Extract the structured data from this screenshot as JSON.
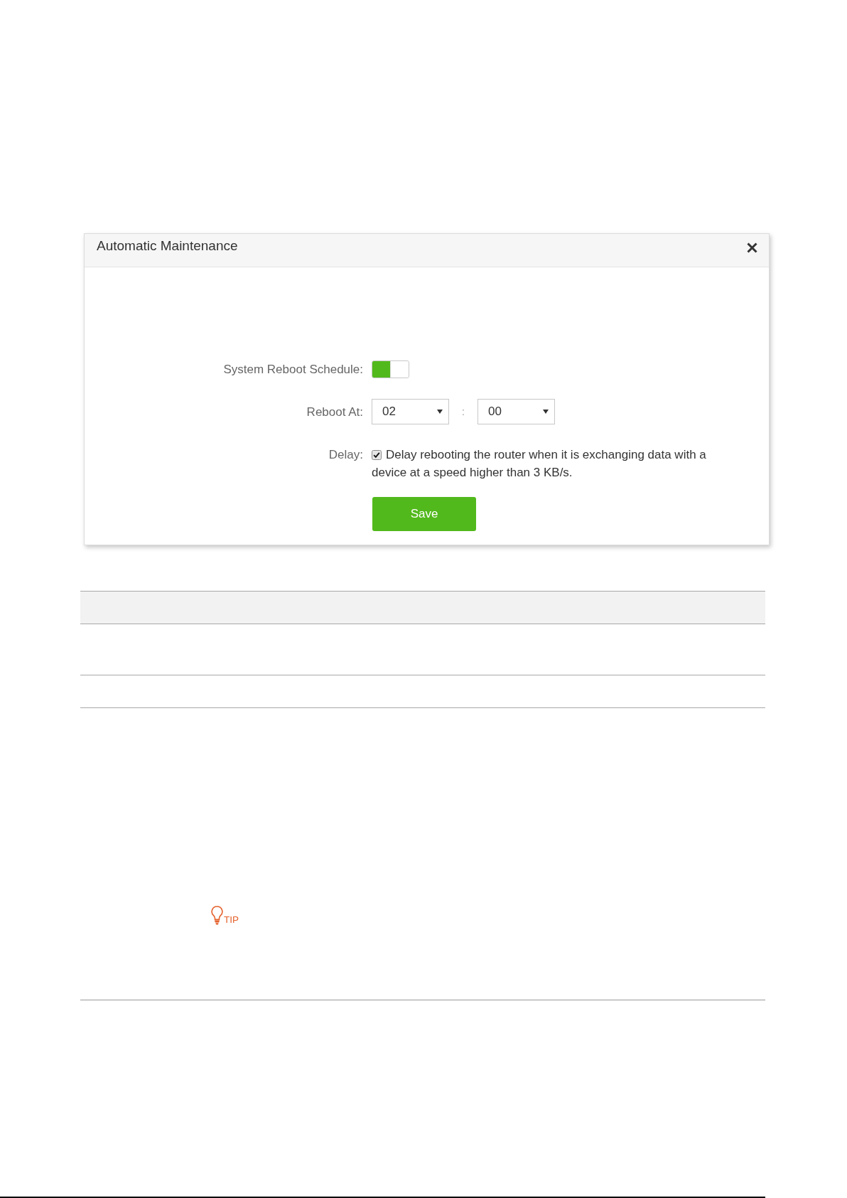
{
  "dialog": {
    "title": "Automatic Maintenance",
    "fields": [
      {
        "kind": "switch",
        "label": "System Reboot Schedule:",
        "on": true
      },
      {
        "kind": "time",
        "label": "Reboot At:",
        "hour": "02",
        "separator": ":",
        "minute": "00"
      },
      {
        "kind": "checkbox",
        "label": "Delay:",
        "checked": true,
        "text": "Delay rebooting the router when it is exchanging data with a device at a speed higher than 3 KB/s."
      }
    ],
    "button": "Save"
  },
  "table": {
    "rows": [
      {
        "kind": "header"
      },
      {
        "kind": "body"
      },
      {
        "kind": "body"
      }
    ]
  },
  "tip": {
    "label": "TIP"
  }
}
